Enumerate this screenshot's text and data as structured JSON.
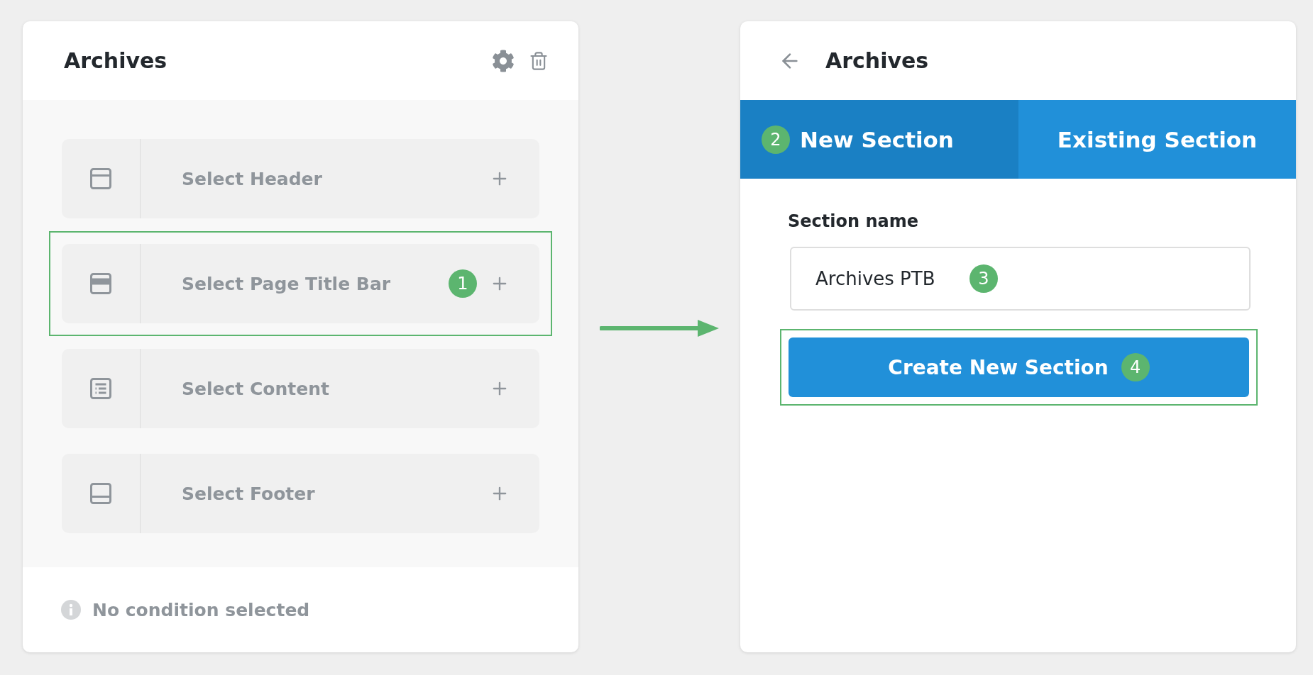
{
  "left_panel": {
    "title": "Archives",
    "rows": [
      {
        "kind": "header",
        "label": "Select Header",
        "highlighted": false
      },
      {
        "kind": "title-bar",
        "label": "Select Page Title Bar",
        "highlighted": true,
        "step": "1"
      },
      {
        "kind": "content",
        "label": "Select Content",
        "highlighted": false
      },
      {
        "kind": "footer",
        "label": "Select Footer",
        "highlighted": false
      }
    ],
    "status": "No condition selected"
  },
  "right_panel": {
    "title": "Archives",
    "tabs": [
      {
        "label": "New Section",
        "selected": true,
        "step": "2"
      },
      {
        "label": "Existing Section",
        "selected": false
      }
    ],
    "field_label": "Section name",
    "field": {
      "value": "Archives PTB",
      "step": "3"
    },
    "button": {
      "label": "Create New Section",
      "highlighted": true,
      "step": "4"
    }
  }
}
